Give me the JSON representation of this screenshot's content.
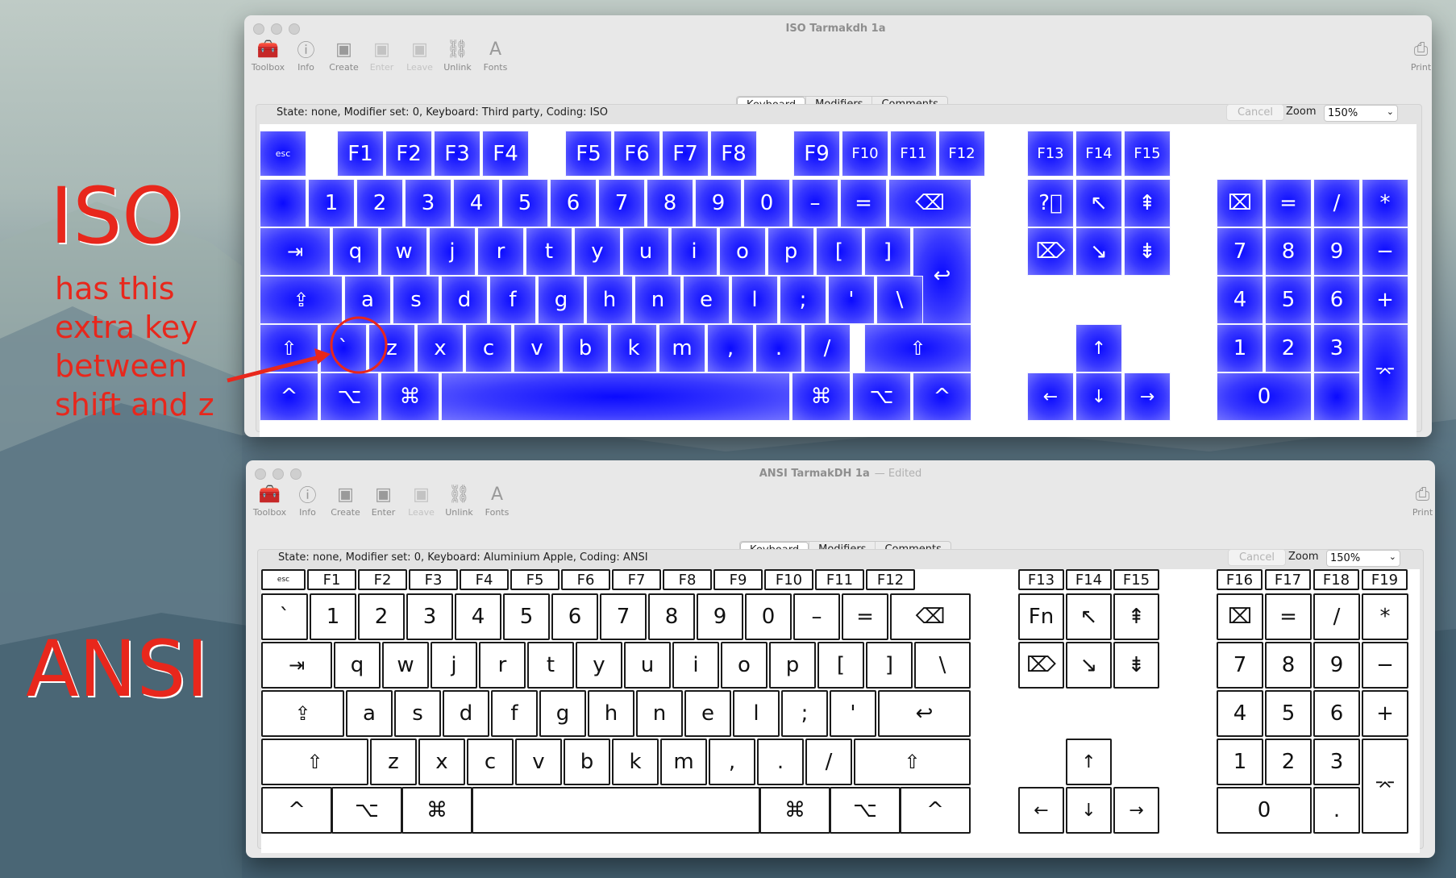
{
  "annotation": {
    "iso_title": "ISO",
    "iso_note": [
      "has this",
      "extra key",
      "between",
      "shift and z"
    ],
    "ansi_title": "ANSI"
  },
  "windows": [
    {
      "id": "iso",
      "title": "ISO Tarmakdh 1a",
      "edited": "",
      "toolbar": [
        "Toolbox",
        "Info",
        "Create",
        "Enter",
        "Leave",
        "Unlink",
        "Fonts"
      ],
      "toolbar_dim": [
        "Enter",
        "Leave"
      ],
      "print_label": "Print",
      "tabs": [
        "Keyboard",
        "Modifiers",
        "Comments"
      ],
      "selected_tab": "Keyboard",
      "state": "State: none, Modifier set: 0, Keyboard: Third party, Coding: ISO",
      "cancel": "Cancel",
      "zoom_label": "Zoom",
      "zoom_value": "150%",
      "keyboard_style": "blue",
      "key_color": "#0000ff"
    },
    {
      "id": "ansi",
      "title": "ANSI TarmakDH 1a",
      "edited": "— Edited",
      "toolbar": [
        "Toolbox",
        "Info",
        "Create",
        "Enter",
        "Leave",
        "Unlink",
        "Fonts"
      ],
      "toolbar_dim": [
        "Leave"
      ],
      "print_label": "Print",
      "tabs": [
        "Keyboard",
        "Modifiers",
        "Comments"
      ],
      "selected_tab": "Keyboard",
      "state": "State: none, Modifier set: 0, Keyboard: Aluminium Apple, Coding: ANSI",
      "cancel": "Cancel",
      "zoom_label": "Zoom",
      "zoom_value": "150%",
      "keyboard_style": "outline",
      "key_color": "#ffffff"
    }
  ],
  "iso_keys": {
    "function_row": [
      "esc",
      "F1",
      "F2",
      "F3",
      "F4",
      "F5",
      "F6",
      "F7",
      "F8",
      "F9",
      "F10",
      "F11",
      "F12",
      "F13",
      "F14",
      "F15"
    ],
    "number_row": [
      "",
      "1",
      "2",
      "3",
      "4",
      "5",
      "6",
      "7",
      "8",
      "9",
      "0",
      "–",
      "=",
      "⌫"
    ],
    "q_row": [
      "⇥",
      "q",
      "w",
      "j",
      "r",
      "t",
      "y",
      "u",
      "i",
      "o",
      "p",
      "[",
      "]",
      "↩"
    ],
    "a_row": [
      "⇪",
      "a",
      "s",
      "d",
      "f",
      "g",
      "h",
      "n",
      "e",
      "l",
      ";",
      "'",
      "\\"
    ],
    "z_row": [
      "⇧",
      "`",
      "z",
      "x",
      "c",
      "v",
      "b",
      "k",
      "m",
      ",",
      ".",
      "/",
      "⇧"
    ],
    "bottom_row": [
      "^",
      "⌥",
      "⌘",
      "",
      "⌘",
      "⌥",
      "^"
    ],
    "nav": [
      "?⃝",
      "↖",
      "⇞",
      "⌦",
      "↘",
      "⇟"
    ],
    "arrows": [
      "↑",
      "←",
      "↓",
      "→"
    ],
    "keypad": [
      "⌧",
      "=",
      "/",
      "*",
      "7",
      "8",
      "9",
      "−",
      "4",
      "5",
      "6",
      "+",
      "1",
      "2",
      "3",
      "⌤",
      "0"
    ]
  },
  "ansi_keys": {
    "function_row": [
      "esc",
      "F1",
      "F2",
      "F3",
      "F4",
      "F5",
      "F6",
      "F7",
      "F8",
      "F9",
      "F10",
      "F11",
      "F12",
      "F13",
      "F14",
      "F15",
      "F16",
      "F17",
      "F18",
      "F19"
    ],
    "number_row": [
      "`",
      "1",
      "2",
      "3",
      "4",
      "5",
      "6",
      "7",
      "8",
      "9",
      "0",
      "–",
      "=",
      "⌫"
    ],
    "q_row": [
      "⇥",
      "q",
      "w",
      "j",
      "r",
      "t",
      "y",
      "u",
      "i",
      "o",
      "p",
      "[",
      "]",
      "\\"
    ],
    "a_row": [
      "⇪",
      "a",
      "s",
      "d",
      "f",
      "g",
      "h",
      "n",
      "e",
      "l",
      ";",
      "'",
      "↩"
    ],
    "z_row": [
      "⇧",
      "z",
      "x",
      "c",
      "v",
      "b",
      "k",
      "m",
      ",",
      ".",
      "/",
      "⇧"
    ],
    "bottom_row": [
      "^",
      "⌥",
      "⌘",
      "",
      "⌘",
      "⌥",
      "^"
    ],
    "nav": [
      "Fn",
      "↖",
      "⇞",
      "⌦",
      "↘",
      "⇟"
    ],
    "arrows": [
      "↑",
      "←",
      "↓",
      "→"
    ],
    "keypad": [
      "⌧",
      "=",
      "/",
      "*",
      "7",
      "8",
      "9",
      "−",
      "4",
      "5",
      "6",
      "+",
      "1",
      "2",
      "3",
      "⌤",
      "0",
      "."
    ]
  }
}
